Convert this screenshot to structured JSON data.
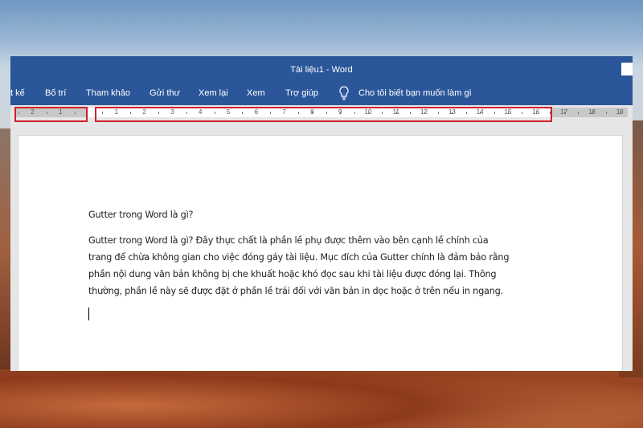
{
  "window": {
    "title": "Tài liệu1 - Word"
  },
  "ribbon": {
    "tabs": [
      "t kế",
      "Bố trí",
      "Tham khảo",
      "Gửi thư",
      "Xem lại",
      "Xem",
      "Trợ giúp"
    ],
    "tell_me": "Cho tôi biết bạn muốn làm gì"
  },
  "ruler": {
    "left_numbers": [
      "2",
      "1"
    ],
    "main_numbers": [
      "1",
      "2",
      "3",
      "4",
      "5",
      "6",
      "7",
      "8",
      "9",
      "10",
      "11",
      "12",
      "13",
      "14",
      "15",
      "16"
    ],
    "right_numbers": [
      "17",
      "18",
      "19"
    ]
  },
  "document": {
    "heading": "Gutter trong Word là gì?",
    "paragraph_lines": [
      "Gutter trong Word là gì? Đây thực chất là phần lề phụ được thêm vào bên cạnh lề chính của",
      "trang để chừa không gian cho việc đóng gáy tài liệu. Mục đích của Gutter chính là đảm bảo rằng",
      "phần nội dung văn bản không bị che khuất hoặc khó đọc sau khi tài liệu được đóng lại. Thông",
      "thường, phần lề này sẽ được đặt ở phần lề trái đối với văn bản in dọc hoặc ở trên nếu in ngang."
    ]
  },
  "colors": {
    "word_blue": "#2b579a",
    "highlight": "#d0202a"
  }
}
